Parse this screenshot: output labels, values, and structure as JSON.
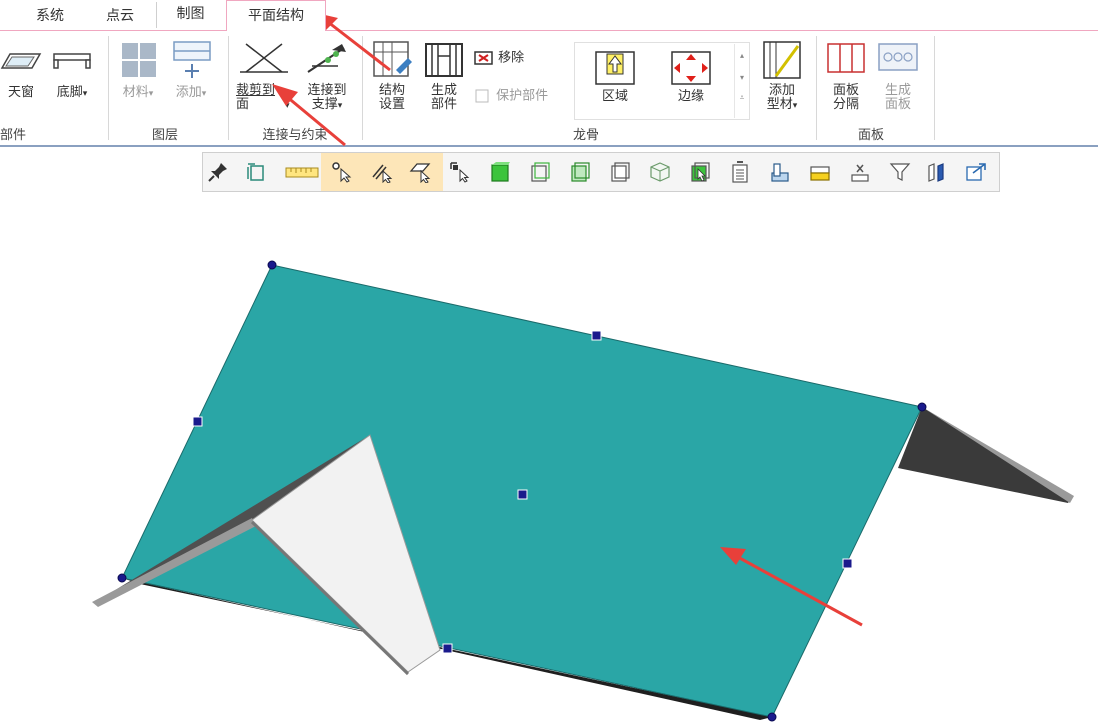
{
  "tabs": [
    {
      "label": "系统"
    },
    {
      "label": "点云"
    },
    {
      "label": "制图"
    },
    {
      "label": "平面结构",
      "active": true
    }
  ],
  "ribbon": {
    "part_group": {
      "label": "部件",
      "buttons": [
        {
          "label": "天窗",
          "icon": "skylight-icon"
        },
        {
          "label": "底脚",
          "icon": "footing-icon",
          "dropdown": "▾"
        }
      ]
    },
    "layer_group": {
      "label": "图层",
      "buttons": [
        {
          "label": "材料",
          "icon": "material-icon",
          "dropdown": "▾",
          "disabled": true
        },
        {
          "label": "添加",
          "icon": "add-layer-icon",
          "dropdown": "▾",
          "disabled": true
        }
      ]
    },
    "connect_group": {
      "label": "连接与约束",
      "buttons": [
        {
          "label_line1": "裁剪到",
          "label_line2": "面",
          "icon": "trim-plane-icon",
          "dropdown": "▾"
        },
        {
          "label_line1": "连接到",
          "label_line2": "支撑",
          "icon": "connect-support-icon",
          "dropdown": "▾"
        }
      ]
    },
    "frame_group": {
      "label": "龙骨",
      "buttons": [
        {
          "label_line1": "结构",
          "label_line2": "设置",
          "icon": "structure-settings-icon"
        },
        {
          "label_line1": "生成",
          "label_line2": "部件",
          "icon": "generate-part-icon"
        },
        {
          "label": "移除",
          "icon": "remove-icon"
        },
        {
          "label": "保护部件",
          "icon": "checkbox-icon",
          "disabled": true
        },
        {
          "label": "区域",
          "icon": "region-icon"
        },
        {
          "label": "边缘",
          "icon": "edge-icon"
        },
        {
          "label_line1": "添加",
          "label_line2": "型材",
          "icon": "add-profile-icon",
          "dropdown": "▾"
        }
      ]
    },
    "panel_group": {
      "label": "面板",
      "buttons": [
        {
          "label_line1": "面板",
          "label_line2": "分隔",
          "icon": "panel-divide-icon"
        },
        {
          "label_line1": "生成",
          "label_line2": "面板",
          "icon": "generate-panel-icon",
          "disabled": true
        }
      ]
    }
  },
  "toolbar": {
    "icons": [
      "pin-icon",
      "rotate-view-icon",
      "ruler-icon",
      "select-point-icon",
      "select-edge-icon",
      "select-face-icon",
      "select-component-icon",
      "box-solid-icon",
      "box-wire-icon",
      "box-shaded-icon",
      "box-outline-icon",
      "box-hidden-icon",
      "box-select-icon",
      "document-icon",
      "layers-icon",
      "stack-icon",
      "clear-icon",
      "filter-icon",
      "columns-icon",
      "export-icon"
    ]
  },
  "colors": {
    "active_tab_border": "#f0a7c0",
    "roof_face": "#2aa6a6",
    "roof_dark": "#3a3a3a",
    "gable_face": "#f2f2f2",
    "handle": "#1a1a8c",
    "arrow": "#e8403a",
    "toolbar_highlight": "#fde6b8"
  }
}
